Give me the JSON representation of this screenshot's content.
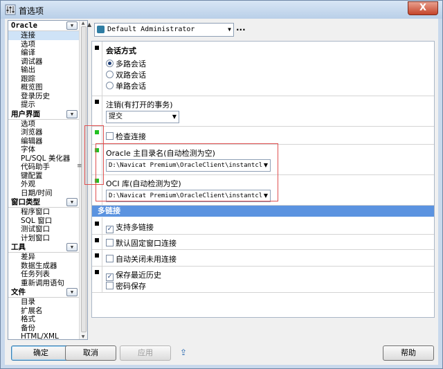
{
  "window": {
    "title": "首选项",
    "close_label": "X"
  },
  "nav": {
    "categories": [
      {
        "label": "Oracle",
        "items": [
          "连接",
          "选项",
          "编译",
          "调试器",
          "输出",
          "跟踪",
          "概览图",
          "登录历史",
          "提示"
        ]
      },
      {
        "label": "用户界面",
        "items": [
          "选项",
          "浏览器",
          "编辑器",
          "字体",
          "PL/SQL 美化器",
          "代码助手",
          "键配置",
          "外观",
          "日期/时间"
        ]
      },
      {
        "label": "窗口类型",
        "items": [
          "程序窗口",
          "SQL 窗口",
          "测试窗口",
          "计划窗口"
        ]
      },
      {
        "label": "工具",
        "items": [
          "差异",
          "数据生成器",
          "任务列表",
          "重新调用语句"
        ]
      },
      {
        "label": "文件",
        "items": [
          "目录",
          "扩展名",
          "格式",
          "备份",
          "HTML/XML"
        ]
      }
    ],
    "selected": "连接"
  },
  "profile": {
    "value": "Default Administrator",
    "more": "..."
  },
  "sections": {
    "session_mode": {
      "title": "会话方式",
      "options": [
        "多路会话",
        "双路会话",
        "单路会话"
      ],
      "selected": 0
    },
    "logoff": {
      "title": "注销(有打开的事务)",
      "value": "提交"
    },
    "check_conn": {
      "label": "检查连接",
      "checked": false
    },
    "oracle_home": {
      "title": "Oracle 主目录名(自动检测为空)",
      "value": "D:\\Navicat Premium\\OracleClient\\instantcl"
    },
    "oci_lib": {
      "title": "OCI 库(自动检测为空)",
      "value": "D:\\Navicat Premium\\OracleClient\\instantcl"
    },
    "multi": {
      "header": "多链接",
      "support": {
        "label": "支持多链接",
        "checked": true
      },
      "fixed": {
        "label": "默认固定窗口连接",
        "checked": false
      },
      "autoclose": {
        "label": "自动关闭未用连接",
        "checked": false
      },
      "history": {
        "label": "保存最近历史",
        "checked": true
      },
      "password": {
        "label": "密码保存",
        "checked": false
      }
    }
  },
  "buttons": {
    "ok": "确定",
    "cancel": "取消",
    "apply": "应用",
    "help": "帮助"
  }
}
